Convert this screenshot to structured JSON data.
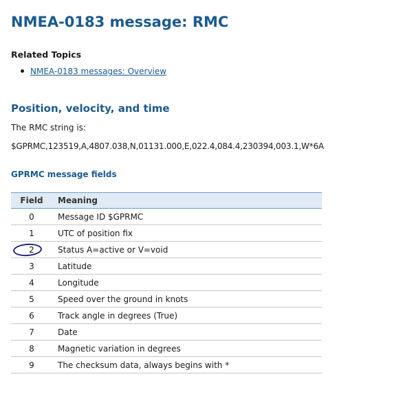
{
  "page": {
    "title": "NMEA-0183 message: RMC"
  },
  "related": {
    "heading": "Related Topics",
    "links": [
      {
        "label": "NMEA-0183 messages: Overview"
      }
    ]
  },
  "section": {
    "heading": "Position, velocity, and time",
    "intro": "The RMC string is:",
    "example": "$GPRMC,123519,A,4807.038,N,01131.000,E,022.4,084.4,230394,003.1,W*6A"
  },
  "fields_table": {
    "heading": "GPRMC message fields",
    "columns": [
      "Field",
      "Meaning"
    ],
    "rows": [
      {
        "field": "0",
        "meaning": "Message ID $GPRMC"
      },
      {
        "field": "1",
        "meaning": "UTC of position fix"
      },
      {
        "field": "2",
        "meaning": "Status A=active or V=void"
      },
      {
        "field": "3",
        "meaning": "Latitude"
      },
      {
        "field": "4",
        "meaning": "Longitude"
      },
      {
        "field": "5",
        "meaning": "Speed over the ground in knots"
      },
      {
        "field": "6",
        "meaning": "Track angle in degrees (True)"
      },
      {
        "field": "7",
        "meaning": "Date"
      },
      {
        "field": "8",
        "meaning": "Magnetic variation in degrees"
      },
      {
        "field": "9",
        "meaning": "The checksum data, always begins with *"
      }
    ]
  },
  "annotation": {
    "circled_field": "2",
    "color": "#23237a"
  },
  "colors": {
    "heading": "#1c5a8e",
    "table_header_bg": "#dfeaf5",
    "table_header_border": "#6b9fcf",
    "row_border": "#c6c6c6"
  }
}
